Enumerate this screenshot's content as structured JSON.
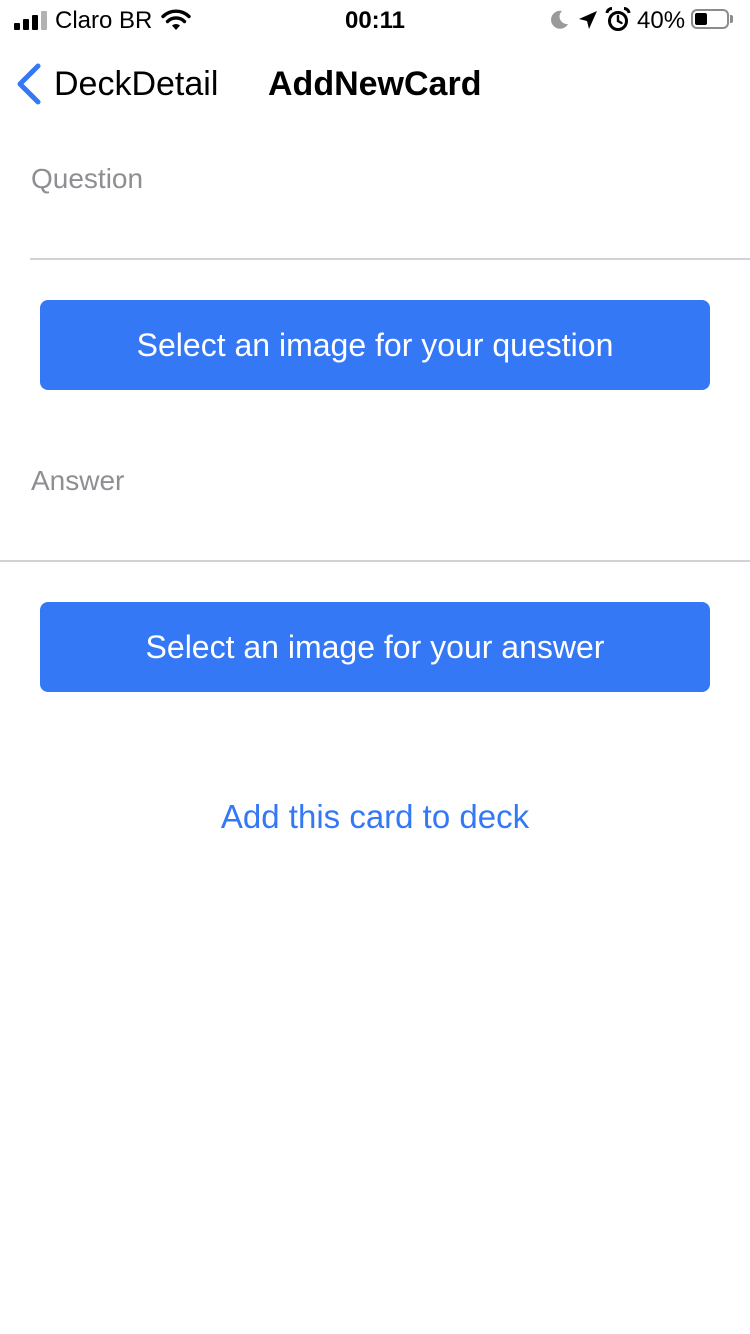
{
  "status_bar": {
    "carrier": "Claro BR",
    "time": "00:11",
    "battery_percent": "40%",
    "battery_level": 0.4,
    "icons": [
      "signal-icon",
      "wifi-icon",
      "moon-icon",
      "location-icon",
      "alarm-icon",
      "battery-icon"
    ]
  },
  "nav": {
    "back_label": "DeckDetail",
    "title": "AddNewCard"
  },
  "form": {
    "question_label": "Question",
    "question_value": "",
    "question_image_button": "Select an image for your question",
    "answer_label": "Answer",
    "answer_value": "",
    "answer_image_button": "Select an image for your answer",
    "submit_label": "Add this card to deck"
  },
  "colors": {
    "accent": "#3478f6",
    "label_gray": "#8e8e93",
    "divider": "#d1d1d6"
  }
}
